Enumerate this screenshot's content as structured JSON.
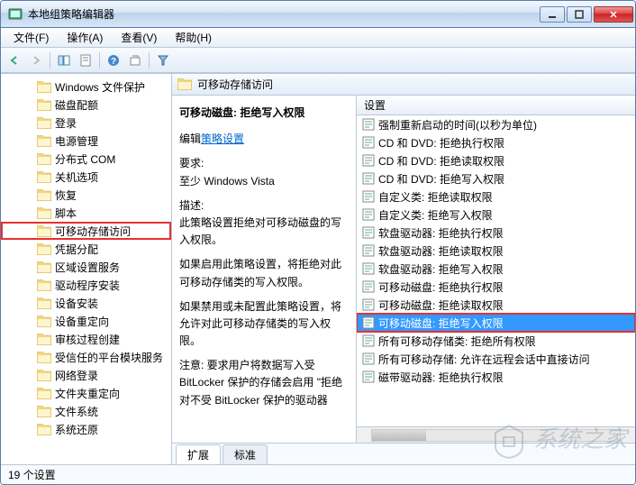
{
  "window": {
    "title": "本地组策略编辑器"
  },
  "menu": {
    "file": "文件(F)",
    "action": "操作(A)",
    "view": "查看(V)",
    "help": "帮助(H)"
  },
  "sidebar": {
    "items": [
      {
        "label": "Windows 文件保护"
      },
      {
        "label": "磁盘配额"
      },
      {
        "label": "登录"
      },
      {
        "label": "电源管理"
      },
      {
        "label": "分布式 COM"
      },
      {
        "label": "关机选项"
      },
      {
        "label": "恢复"
      },
      {
        "label": "脚本"
      },
      {
        "label": "可移动存储访问",
        "highlighted": true
      },
      {
        "label": "凭据分配"
      },
      {
        "label": "区域设置服务"
      },
      {
        "label": "驱动程序安装"
      },
      {
        "label": "设备安装"
      },
      {
        "label": "设备重定向"
      },
      {
        "label": "审核过程创建"
      },
      {
        "label": "受信任的平台模块服务"
      },
      {
        "label": "网络登录"
      },
      {
        "label": "文件夹重定向"
      },
      {
        "label": "文件系统"
      },
      {
        "label": "系统还原"
      }
    ]
  },
  "main": {
    "header": "可移动存储访问",
    "detail": {
      "title": "可移动磁盘: 拒绝写入权限",
      "edit_prefix": "编辑",
      "edit_link": "策略设置",
      "req_label": "要求:",
      "req_value": "至少 Windows Vista",
      "desc_label": "描述:",
      "desc_1": "此策略设置拒绝对可移动磁盘的写入权限。",
      "desc_2": "如果启用此策略设置，将拒绝对此可移动存储类的写入权限。",
      "desc_3": "如果禁用或未配置此策略设置，将允许对此可移动存储类的写入权限。",
      "desc_4": "注意: 要求用户将数据写入受 BitLocker 保护的存储会启用 \"拒绝对不受 BitLocker 保护的驱动器"
    },
    "list": {
      "header": "设置",
      "items": [
        {
          "label": "强制重新启动的时间(以秒为单位)"
        },
        {
          "label": "CD 和 DVD: 拒绝执行权限"
        },
        {
          "label": "CD 和 DVD: 拒绝读取权限"
        },
        {
          "label": "CD 和 DVD: 拒绝写入权限"
        },
        {
          "label": "自定义类: 拒绝读取权限"
        },
        {
          "label": "自定义类: 拒绝写入权限"
        },
        {
          "label": "软盘驱动器: 拒绝执行权限"
        },
        {
          "label": "软盘驱动器: 拒绝读取权限"
        },
        {
          "label": "软盘驱动器: 拒绝写入权限"
        },
        {
          "label": "可移动磁盘: 拒绝执行权限"
        },
        {
          "label": "可移动磁盘: 拒绝读取权限"
        },
        {
          "label": "可移动磁盘: 拒绝写入权限",
          "selected": true,
          "highlighted": true
        },
        {
          "label": "所有可移动存储类: 拒绝所有权限"
        },
        {
          "label": "所有可移动存储: 允许在远程会话中直接访问"
        },
        {
          "label": "磁带驱动器: 拒绝执行权限"
        }
      ]
    },
    "tabs": {
      "extended": "扩展",
      "standard": "标准"
    }
  },
  "statusbar": {
    "text": "19 个设置"
  },
  "watermark": "系统之家"
}
